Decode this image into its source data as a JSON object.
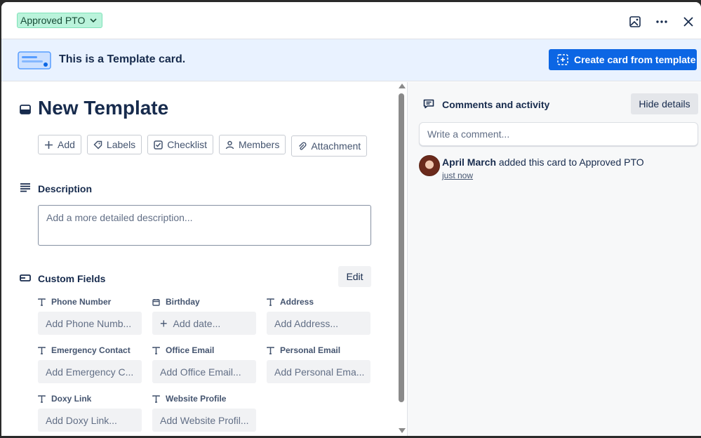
{
  "header": {
    "list_name": "Approved PTO",
    "actions": [
      "image-icon",
      "more-icon",
      "close-icon"
    ]
  },
  "banner": {
    "text": "This is a Template card.",
    "create_button": "Create card from template"
  },
  "card": {
    "title": "New Template",
    "actions": [
      {
        "label": "Add",
        "icon": "plus-icon"
      },
      {
        "label": "Labels",
        "icon": "tag-icon"
      },
      {
        "label": "Checklist",
        "icon": "checkbox-icon"
      },
      {
        "label": "Members",
        "icon": "user-icon"
      },
      {
        "label": "Attachment",
        "icon": "paperclip-icon"
      }
    ]
  },
  "description": {
    "title": "Description",
    "placeholder": "Add a more detailed description..."
  },
  "custom_fields": {
    "title": "Custom Fields",
    "edit_label": "Edit",
    "fields": [
      {
        "label": "Phone Number",
        "placeholder": "Add Phone Numb..."
      },
      {
        "label": "Birthday",
        "placeholder": "Add date..."
      },
      {
        "label": "Address",
        "placeholder": "Add Address..."
      },
      {
        "label": "Emergency Contact",
        "placeholder": "Add Emergency C..."
      },
      {
        "label": "Office Email",
        "placeholder": "Add Office Email..."
      },
      {
        "label": "Personal Email",
        "placeholder": "Add Personal Ema..."
      },
      {
        "label": "Doxy Link",
        "placeholder": "Add Doxy Link..."
      },
      {
        "label": "Website Profile",
        "placeholder": "Add Website Profil..."
      }
    ]
  },
  "sidebar": {
    "title": "Comments and activity",
    "hide_label": "Hide details",
    "comment_placeholder": "Write a comment...",
    "activity": {
      "user": "April March",
      "action": "added this card to Approved PTO",
      "time": "just now"
    }
  },
  "colors": {
    "list_pill": "#baf3db",
    "banner": "#e9f2ff",
    "primary_button": "#0c66e4"
  }
}
